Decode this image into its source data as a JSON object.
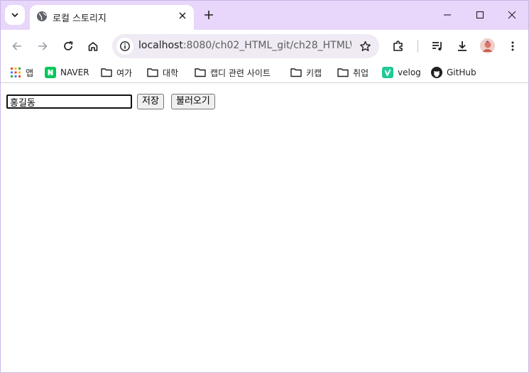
{
  "browser": {
    "tab": {
      "title": "로컬 스토리지",
      "favicon": "globe-icon"
    },
    "address_bar": {
      "host": "localhost",
      "path": ":8080/ch02_HTML_git/ch28_HTMLW..."
    },
    "colors": {
      "tab_strip": "#e8d6fb",
      "omnibox": "#efeaf3"
    }
  },
  "bookmarks": [
    {
      "label": "앱",
      "icon": "apps-grid-icon"
    },
    {
      "label": "NAVER",
      "icon": "naver-icon"
    },
    {
      "label": "여가",
      "icon": "folder-icon"
    },
    {
      "label": "대학",
      "icon": "folder-icon"
    },
    {
      "label": "캡디 관련 사이트",
      "icon": "folder-icon"
    },
    {
      "label": "키캡",
      "icon": "folder-icon"
    },
    {
      "label": "취업",
      "icon": "folder-icon"
    },
    {
      "label": "velog",
      "icon": "velog-icon"
    },
    {
      "label": "GitHub",
      "icon": "github-icon"
    }
  ],
  "page": {
    "name_input": {
      "value": "홍길동"
    },
    "save_button": "저장",
    "load_button": "불러오기"
  }
}
